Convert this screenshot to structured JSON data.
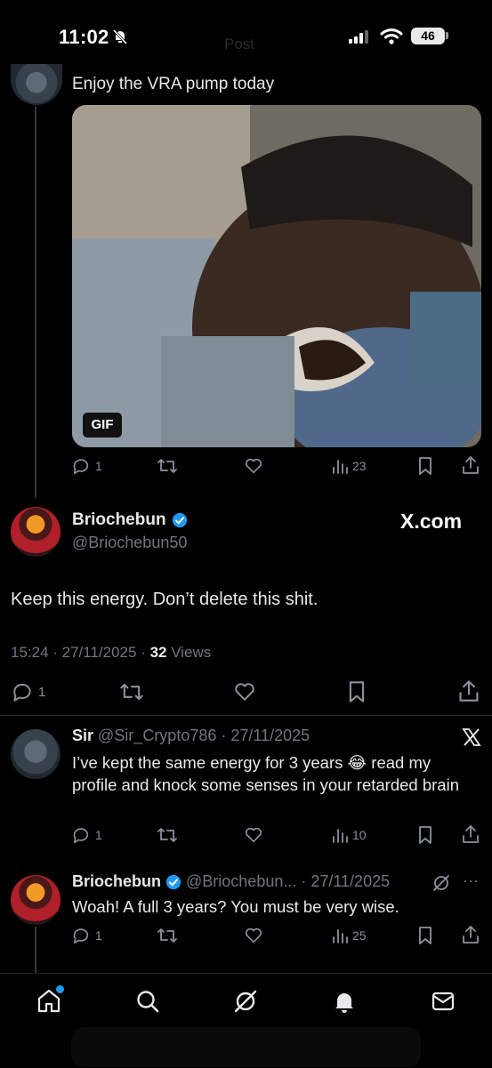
{
  "status_bar": {
    "time": "11:02",
    "battery": "46",
    "ghost_title": "Post"
  },
  "post1": {
    "text": "Enjoy the VRA pump today",
    "gif_label": "GIF",
    "replies": "1",
    "retweets": "",
    "likes": "",
    "views": "23"
  },
  "main_post": {
    "name": "Briochebun",
    "handle": "@Briochebun50",
    "watermark": "X.com",
    "text": "Keep this energy. Don’t delete this shit.",
    "timestamp": "15:24 · 27/11/2025 ·",
    "views_count": "32",
    "views_label": "Views",
    "replies": "1"
  },
  "reply1": {
    "name": "Sir",
    "handle_date": "@Sir_Crypto786 · 27/11/2025",
    "text_a": "I’ve kept the same energy for 3 years ",
    "emoji": "😂",
    "text_b": " read my profile and knock some senses in your retarded brain",
    "replies": "1",
    "views": "10"
  },
  "reply2": {
    "name": "Briochebun",
    "handle_date": "@Briochebun... · 27/11/2025",
    "more": "···",
    "text": "Woah! A full 3 years? You must be very wise.",
    "replies": "1",
    "views": "25"
  },
  "colors": {
    "accent": "#1d9bf0",
    "muted": "#71767b",
    "bg": "#000000"
  },
  "icons": [
    "reply-icon",
    "retweet-icon",
    "like-icon",
    "views-icon",
    "bookmark-icon",
    "share-icon",
    "x-logo-icon",
    "grok-icon",
    "home-icon",
    "search-icon",
    "bell-icon",
    "mail-icon"
  ]
}
